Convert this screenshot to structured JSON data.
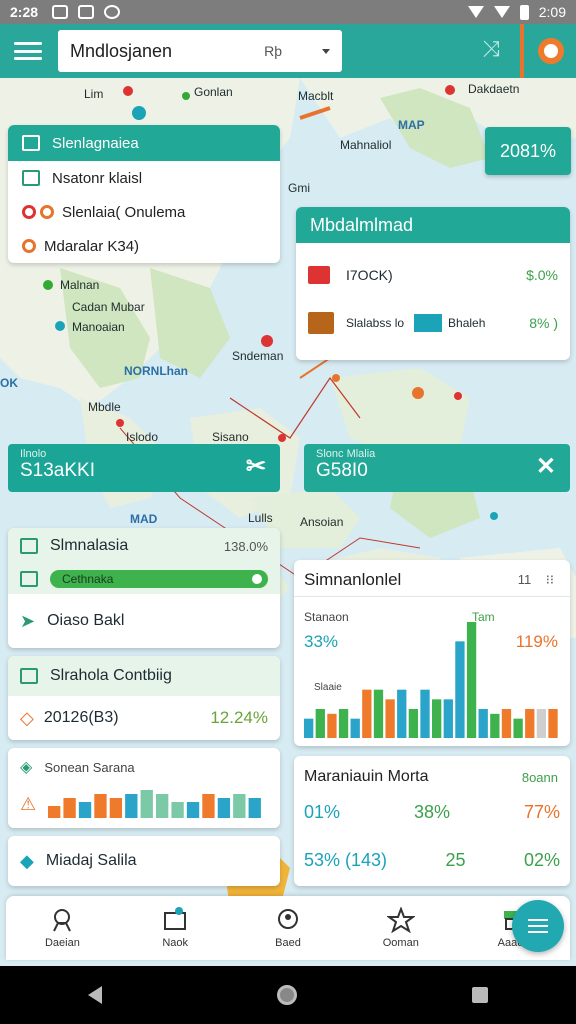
{
  "status_bar": {
    "time": "2:28",
    "clock_right": "2:09"
  },
  "app_bar": {
    "search_value": "Mndlosjanen",
    "search_mid": "Rþ"
  },
  "map": {
    "labels": [
      "Lim",
      "Gonlan",
      "Macblt",
      "Dakdaetn",
      "MAP",
      "Mahnaliol",
      "Gmi",
      "Malnan",
      "Cadan Mubar",
      "Manoaian",
      "Sndeman",
      "NORNLhan",
      "Mbdle",
      "Islodo",
      "Sisano",
      "Lulls",
      "Ansoian",
      "MAD",
      "OK"
    ]
  },
  "badge_pct": "2081%",
  "info_card": {
    "header": "Slenlagnaiea",
    "row1": "Nsatonr klaisl",
    "row2": "Slenlaia( Onulema",
    "row3": "Mdaralar K34)"
  },
  "right_card": {
    "header": "Mbdalmlmad",
    "row1_label": "I7OCK)",
    "row1_value": "$.0%",
    "row2_label": "Slalabss lo",
    "row2_mid": "Bhaleh",
    "row2_value": "8% )"
  },
  "teal_bar_left": {
    "small": "Ilnolo",
    "big": "S13aKKI"
  },
  "teal_bar_right": {
    "small": "Slonc Mlalia",
    "big": "G58I0"
  },
  "card_sim": {
    "title": "Slmnalasia",
    "value": "138.0%",
    "chip": "Cethnaka",
    "row": "Oiaso Bakl"
  },
  "card_cont": {
    "title": "Slrahola Contbiig",
    "value_label": "20126(B3)",
    "value": "12.24%"
  },
  "card_sonac": {
    "title": "Sonean Sarana"
  },
  "card_miadaj": {
    "title": "Miadaj Salila"
  },
  "chart_card": {
    "title": "Simnanlonlel",
    "ctrl": "11",
    "series_label": "Stanaon",
    "left_pct": "33%",
    "right_small": "Tam",
    "right_pct": "119%",
    "inner_label": "Slaaie"
  },
  "stats_card": {
    "title": "Maraniauin Morta",
    "sub": "8oann",
    "row1": [
      "01%",
      "38%",
      "77%"
    ],
    "row2": [
      "53% (143)",
      "25",
      "02%"
    ]
  },
  "bottom_nav": {
    "items": [
      "Daeian",
      "Naok",
      "Baed",
      "Ooman",
      "Aaaon"
    ]
  },
  "chart_data": [
    {
      "type": "bar",
      "title": "Simnanlonlel",
      "values": [
        4,
        6,
        5,
        6,
        4,
        10,
        10,
        8,
        10,
        6,
        10,
        8,
        8,
        20,
        24,
        6,
        5,
        6,
        4,
        6,
        6,
        6
      ],
      "colors": [
        "#2aa4c9",
        "#3db24d",
        "#f07a2c",
        "#3db24d",
        "#2aa4c9",
        "#f07a2c",
        "#3db24d",
        "#f07a2c",
        "#2aa4c9",
        "#3db24d",
        "#2aa4c9",
        "#3db24d",
        "#2aa4c9",
        "#2aa4c9",
        "#3db24d",
        "#2aa4c9",
        "#3db24d",
        "#f07a2c",
        "#3db24d",
        "#f07a2c",
        "#cfcfcf",
        "#f07a2c"
      ],
      "ylim": [
        0,
        24
      ]
    },
    {
      "type": "bar",
      "title": "Sonean Sarana",
      "values": [
        3,
        5,
        4,
        6,
        5,
        6,
        7,
        6,
        4,
        4,
        6,
        5,
        6,
        5
      ],
      "colors": [
        "#f07a2c",
        "#f07a2c",
        "#2aa4c9",
        "#f07a2c",
        "#f07a2c",
        "#2aa4c9",
        "#7cc9a8",
        "#7cc9a8",
        "#7cc9a8",
        "#2aa4c9",
        "#f07a2c",
        "#2aa4c9",
        "#7cc9a8",
        "#2aa4c9"
      ],
      "ylim": [
        0,
        7
      ]
    }
  ]
}
